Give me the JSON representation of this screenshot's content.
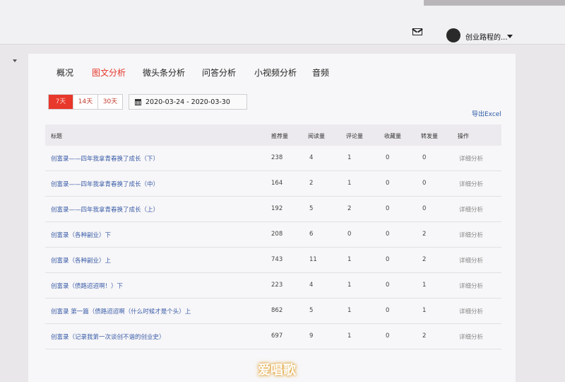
{
  "header": {
    "user_name": "创业路程的..."
  },
  "tabs": [
    {
      "label": "概况",
      "active": false
    },
    {
      "label": "图文分析",
      "active": true
    },
    {
      "label": "微头条分析",
      "active": false
    },
    {
      "label": "问答分析",
      "active": false
    },
    {
      "label": "小视频分析",
      "active": false
    },
    {
      "label": "音频",
      "active": false
    }
  ],
  "filters": {
    "ranges": [
      {
        "label": "7天",
        "active": true
      },
      {
        "label": "14天",
        "active": false
      },
      {
        "label": "30天",
        "active": false
      }
    ],
    "date_range": "2020-03-24 - 2020-03-30"
  },
  "export_label": "导出Excel",
  "table": {
    "headers": [
      "标题",
      "推荐量",
      "阅读量",
      "评论量",
      "收藏量",
      "转发量",
      "操作"
    ],
    "rows": [
      {
        "title": "创富录——四年我拿青春换了成长（下）",
        "rec": "238",
        "read": "4",
        "comment": "1",
        "fav": "0",
        "share": "0",
        "op": "详细分析"
      },
      {
        "title": "创富录——四年我拿青春换了成长（中）",
        "rec": "164",
        "read": "2",
        "comment": "1",
        "fav": "0",
        "share": "0",
        "op": "详细分析"
      },
      {
        "title": "创富录——四年我拿青春换了成长（上）",
        "rec": "192",
        "read": "5",
        "comment": "2",
        "fav": "0",
        "share": "0",
        "op": "详细分析"
      },
      {
        "title": "创富录（各种副业）下",
        "rec": "208",
        "read": "6",
        "comment": "0",
        "fav": "0",
        "share": "2",
        "op": "详细分析"
      },
      {
        "title": "创富录（各种副业）上",
        "rec": "743",
        "read": "11",
        "comment": "1",
        "fav": "0",
        "share": "2",
        "op": "详细分析"
      },
      {
        "title": "创富录（债路迢迢啊！）下",
        "rec": "223",
        "read": "4",
        "comment": "1",
        "fav": "0",
        "share": "1",
        "op": "详细分析"
      },
      {
        "title": "创富录 第一篇（债路迢迢啊（什么时候才是个头）上",
        "rec": "862",
        "read": "5",
        "comment": "1",
        "fav": "0",
        "share": "1",
        "op": "详细分析"
      },
      {
        "title": "创富录（记录我第一次谈创不谐的创业史）",
        "rec": "697",
        "read": "9",
        "comment": "1",
        "fav": "0",
        "share": "2",
        "op": "详细分析"
      }
    ]
  },
  "watermark": "爱唱歌"
}
